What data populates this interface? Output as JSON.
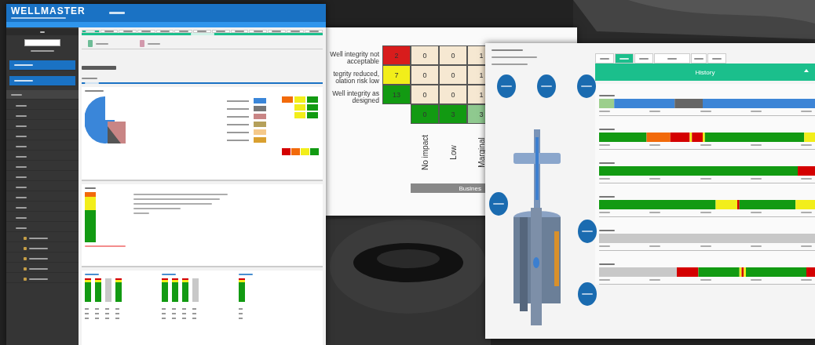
{
  "main_window": {
    "brand": "WELLMASTER",
    "tabs": [
      {
        "selected": true
      },
      {
        "selected": false
      },
      {
        "selected": false
      },
      {
        "selected": false
      },
      {
        "selected": false
      },
      {
        "selected": false
      },
      {
        "selected": false
      },
      {
        "selected": false
      },
      {
        "selected": false
      },
      {
        "selected": false
      },
      {
        "selected": false
      },
      {
        "selected": false
      },
      {
        "selected": false
      }
    ],
    "sidebar_items": [
      {
        "kind": "section"
      },
      {
        "kind": "section"
      },
      {
        "kind": "group"
      },
      {
        "kind": "leaf"
      },
      {
        "kind": "leaf"
      },
      {
        "kind": "leaf"
      },
      {
        "kind": "leaf"
      },
      {
        "kind": "leaf"
      },
      {
        "kind": "leaf"
      },
      {
        "kind": "leaf"
      },
      {
        "kind": "leaf"
      },
      {
        "kind": "leaf"
      },
      {
        "kind": "leaf"
      },
      {
        "kind": "leaf"
      },
      {
        "kind": "leaf"
      },
      {
        "kind": "leaf"
      },
      {
        "kind": "sub"
      },
      {
        "kind": "sub"
      },
      {
        "kind": "sub"
      },
      {
        "kind": "sub"
      },
      {
        "kind": "sub"
      }
    ]
  },
  "risk_matrix": {
    "row_labels": [
      "Well integrity not acceptable",
      "tegrity reduced, olation risk low",
      "Well integrity as designed"
    ],
    "rows": [
      {
        "cells": [
          {
            "value": "2",
            "color": "#d81c1c"
          },
          {
            "value": "0",
            "color": "#f6e8d2"
          },
          {
            "value": "0",
            "color": "#f6e8d2"
          },
          {
            "value": "1",
            "color": "#f6e8d2"
          }
        ]
      },
      {
        "cells": [
          {
            "value": "7",
            "color": "#f2ee1a"
          },
          {
            "value": "0",
            "color": "#f6e8d2"
          },
          {
            "value": "0",
            "color": "#f6e8d2"
          },
          {
            "value": "1",
            "color": "#f6e8d2"
          }
        ]
      },
      {
        "cells": [
          {
            "value": "13",
            "color": "#129a12"
          },
          {
            "value": "0",
            "color": "#f6e8d2"
          },
          {
            "value": "0",
            "color": "#f6e8d2"
          },
          {
            "value": "1",
            "color": "#f6e8d2"
          }
        ]
      }
    ],
    "totals": [
      {
        "value": "0",
        "color": "#129a12"
      },
      {
        "value": "3",
        "color": "#129a12"
      },
      {
        "value": "3",
        "color": "#8fc98f"
      }
    ],
    "column_labels": [
      "No impact",
      "Low",
      "Marginal"
    ],
    "axis_title": "Busines"
  },
  "detail_window": {
    "tabs": [
      {
        "selected": false
      },
      {
        "selected": true
      },
      {
        "selected": false
      },
      {
        "selected": false
      },
      {
        "selected": false
      },
      {
        "selected": false
      }
    ],
    "banner": "History",
    "nodes": [
      {
        "kind": "node"
      },
      {
        "kind": "node"
      },
      {
        "kind": "node"
      },
      {
        "kind": "node"
      },
      {
        "kind": "node"
      },
      {
        "kind": "node"
      }
    ]
  }
}
